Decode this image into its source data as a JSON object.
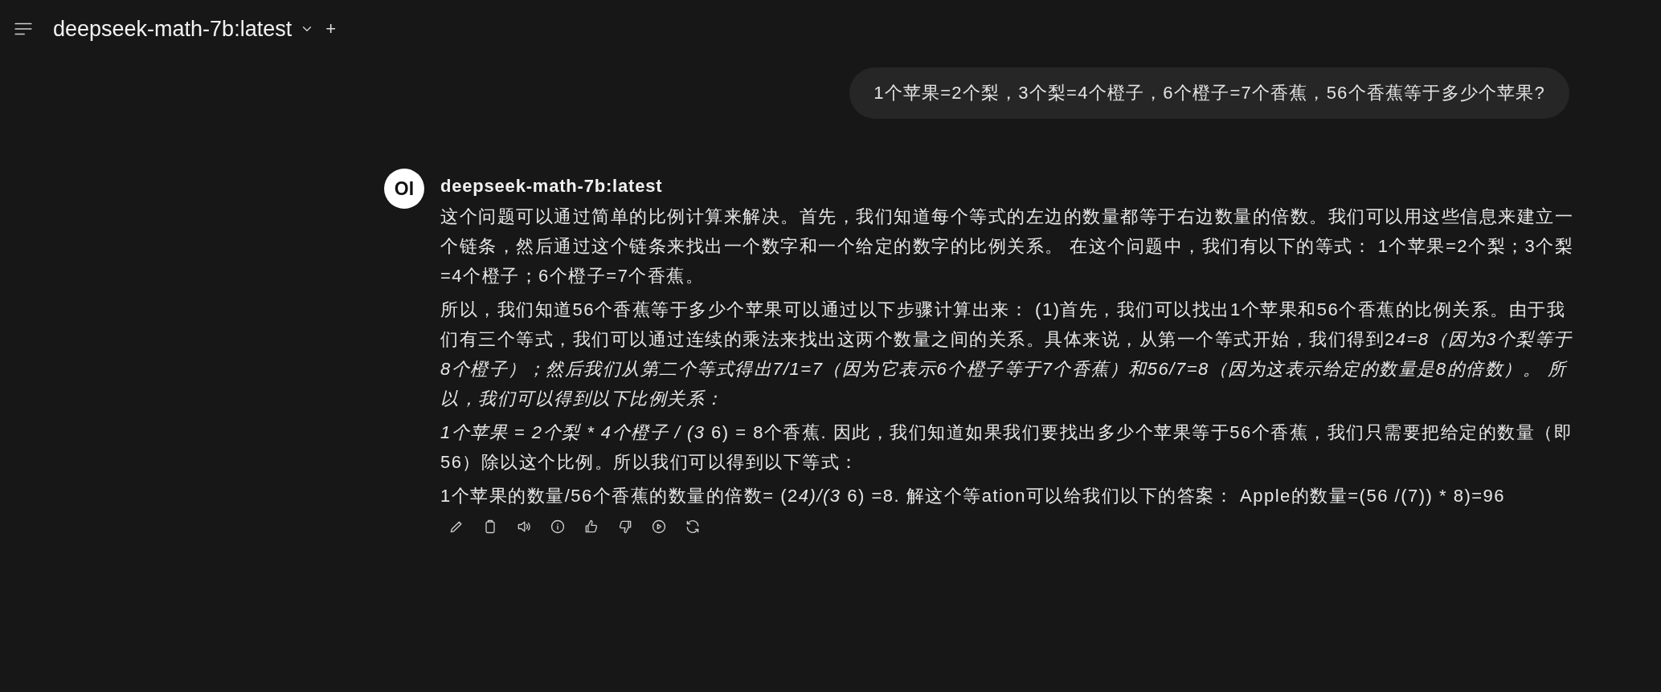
{
  "header": {
    "model_title": "deepseek-math-7b:latest",
    "new_chat": "+"
  },
  "user_message": {
    "text": "1个苹果=2个梨，3个梨=4个橙子，6个橙子=7个香蕉，56个香蕉等于多少个苹果?"
  },
  "assistant_message": {
    "avatar": "OI",
    "model_name": "deepseek-math-7b:latest",
    "paragraphs": [
      [
        {
          "text": "这个问题可以通过简单的比例计算来解决。首先，我们知道每个等式的左边的数量都等于右边数量的倍数。我们可以用这些信息来建立一个链条，然后通过这个链条来找出一个数字和一个给定的数字的比例关系。 在这个问题中，我们有以下的等式： 1个苹果=2个梨；3个梨=4个橙子；6个橙子=7个香蕉。",
          "italic": false
        }
      ],
      [
        {
          "text": "所以，我们知道56个香蕉等于多少个苹果可以通过以下步骤计算出来： (1)首先，我们可以找出1个苹果和56个香蕉的比例关系。由于我们有三个等式，我们可以通过连续的乘法来找出这两个数量之间的关系。具体来说，从第一个等式开始，我们得到2",
          "italic": false
        },
        {
          "text": "4=8（因为3个梨等于8个橙子）；然后我们从第二个等式得出7/1=7（因为它表示6个橙子等于7个香蕉）和56/7=8（因为这表示给定的数量是8的倍数）。 所以，我们可以得到以下比例关系：",
          "italic": true
        }
      ],
      [
        {
          "text": "1个苹果 = 2个梨 * 4个橙子 / (3",
          "italic": true
        },
        {
          "text": " 6) = 8个香蕉. 因此，我们知道如果我们要找出多少个苹果等于56个香蕉，我们只需要把给定的数量（即56）除以这个比例。所以我们可以得到以下等式：",
          "italic": false
        }
      ],
      [
        {
          "text": "1个苹果的数量/56个香蕉的数量的倍数= (2",
          "italic": false
        },
        {
          "text": "4)/(3",
          "italic": true
        },
        {
          "text": " 6) =8. 解这个等ation可以给我们以下的答案：  Apple的数量=(56 /(7)) * 8)=96",
          "italic": false
        }
      ]
    ]
  }
}
